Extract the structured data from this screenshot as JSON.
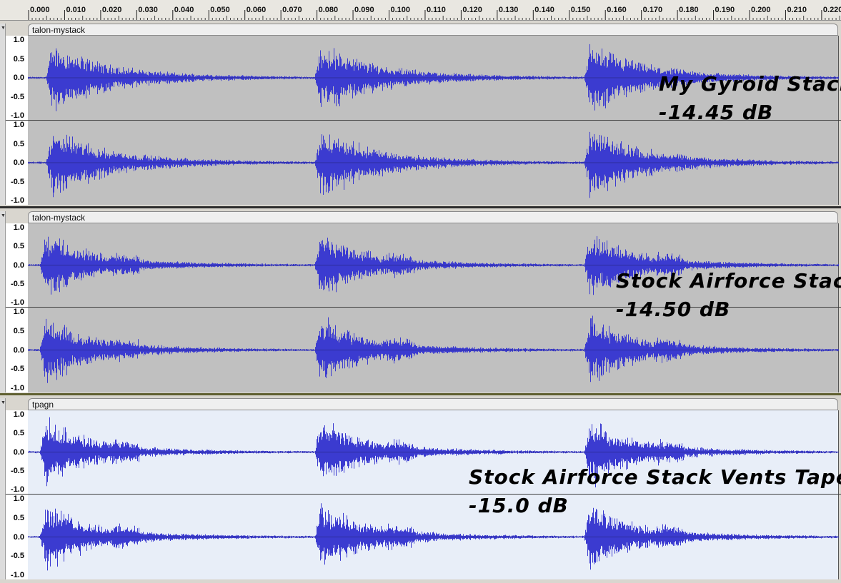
{
  "ruler": {
    "ticks": [
      "0.000",
      "0.010",
      "0.020",
      "0.030",
      "0.040",
      "0.050",
      "0.060",
      "0.070",
      "0.080",
      "0.090",
      "0.100",
      "0.110",
      "0.120",
      "0.130",
      "0.140",
      "0.150",
      "0.160",
      "0.170",
      "0.180",
      "0.190",
      "0.200",
      "0.210",
      "0.220"
    ]
  },
  "amplitude_labels": [
    "1.0",
    "0.5",
    "0.0",
    "-0.5",
    "-1.0"
  ],
  "colors": {
    "waveform": "#3b3bd0",
    "unselected_bg": "#c0c0c0",
    "selected_bg": "#e8eef8",
    "midline": "#000000"
  },
  "tracks": [
    {
      "name": "talon-mystack",
      "selected": false,
      "annotation_line1": "My Gyroid Stack",
      "annotation_line2": "-14.45 dB"
    },
    {
      "name": "talon-mystack",
      "selected": false,
      "annotation_line1": "Stock Airforce Stack",
      "annotation_line2": "-14.50 dB"
    },
    {
      "name": "tpagn",
      "selected": true,
      "annotation_line1": "Stock Airforce Stack Vents Taped",
      "annotation_line2": "-15.0 dB"
    }
  ]
}
